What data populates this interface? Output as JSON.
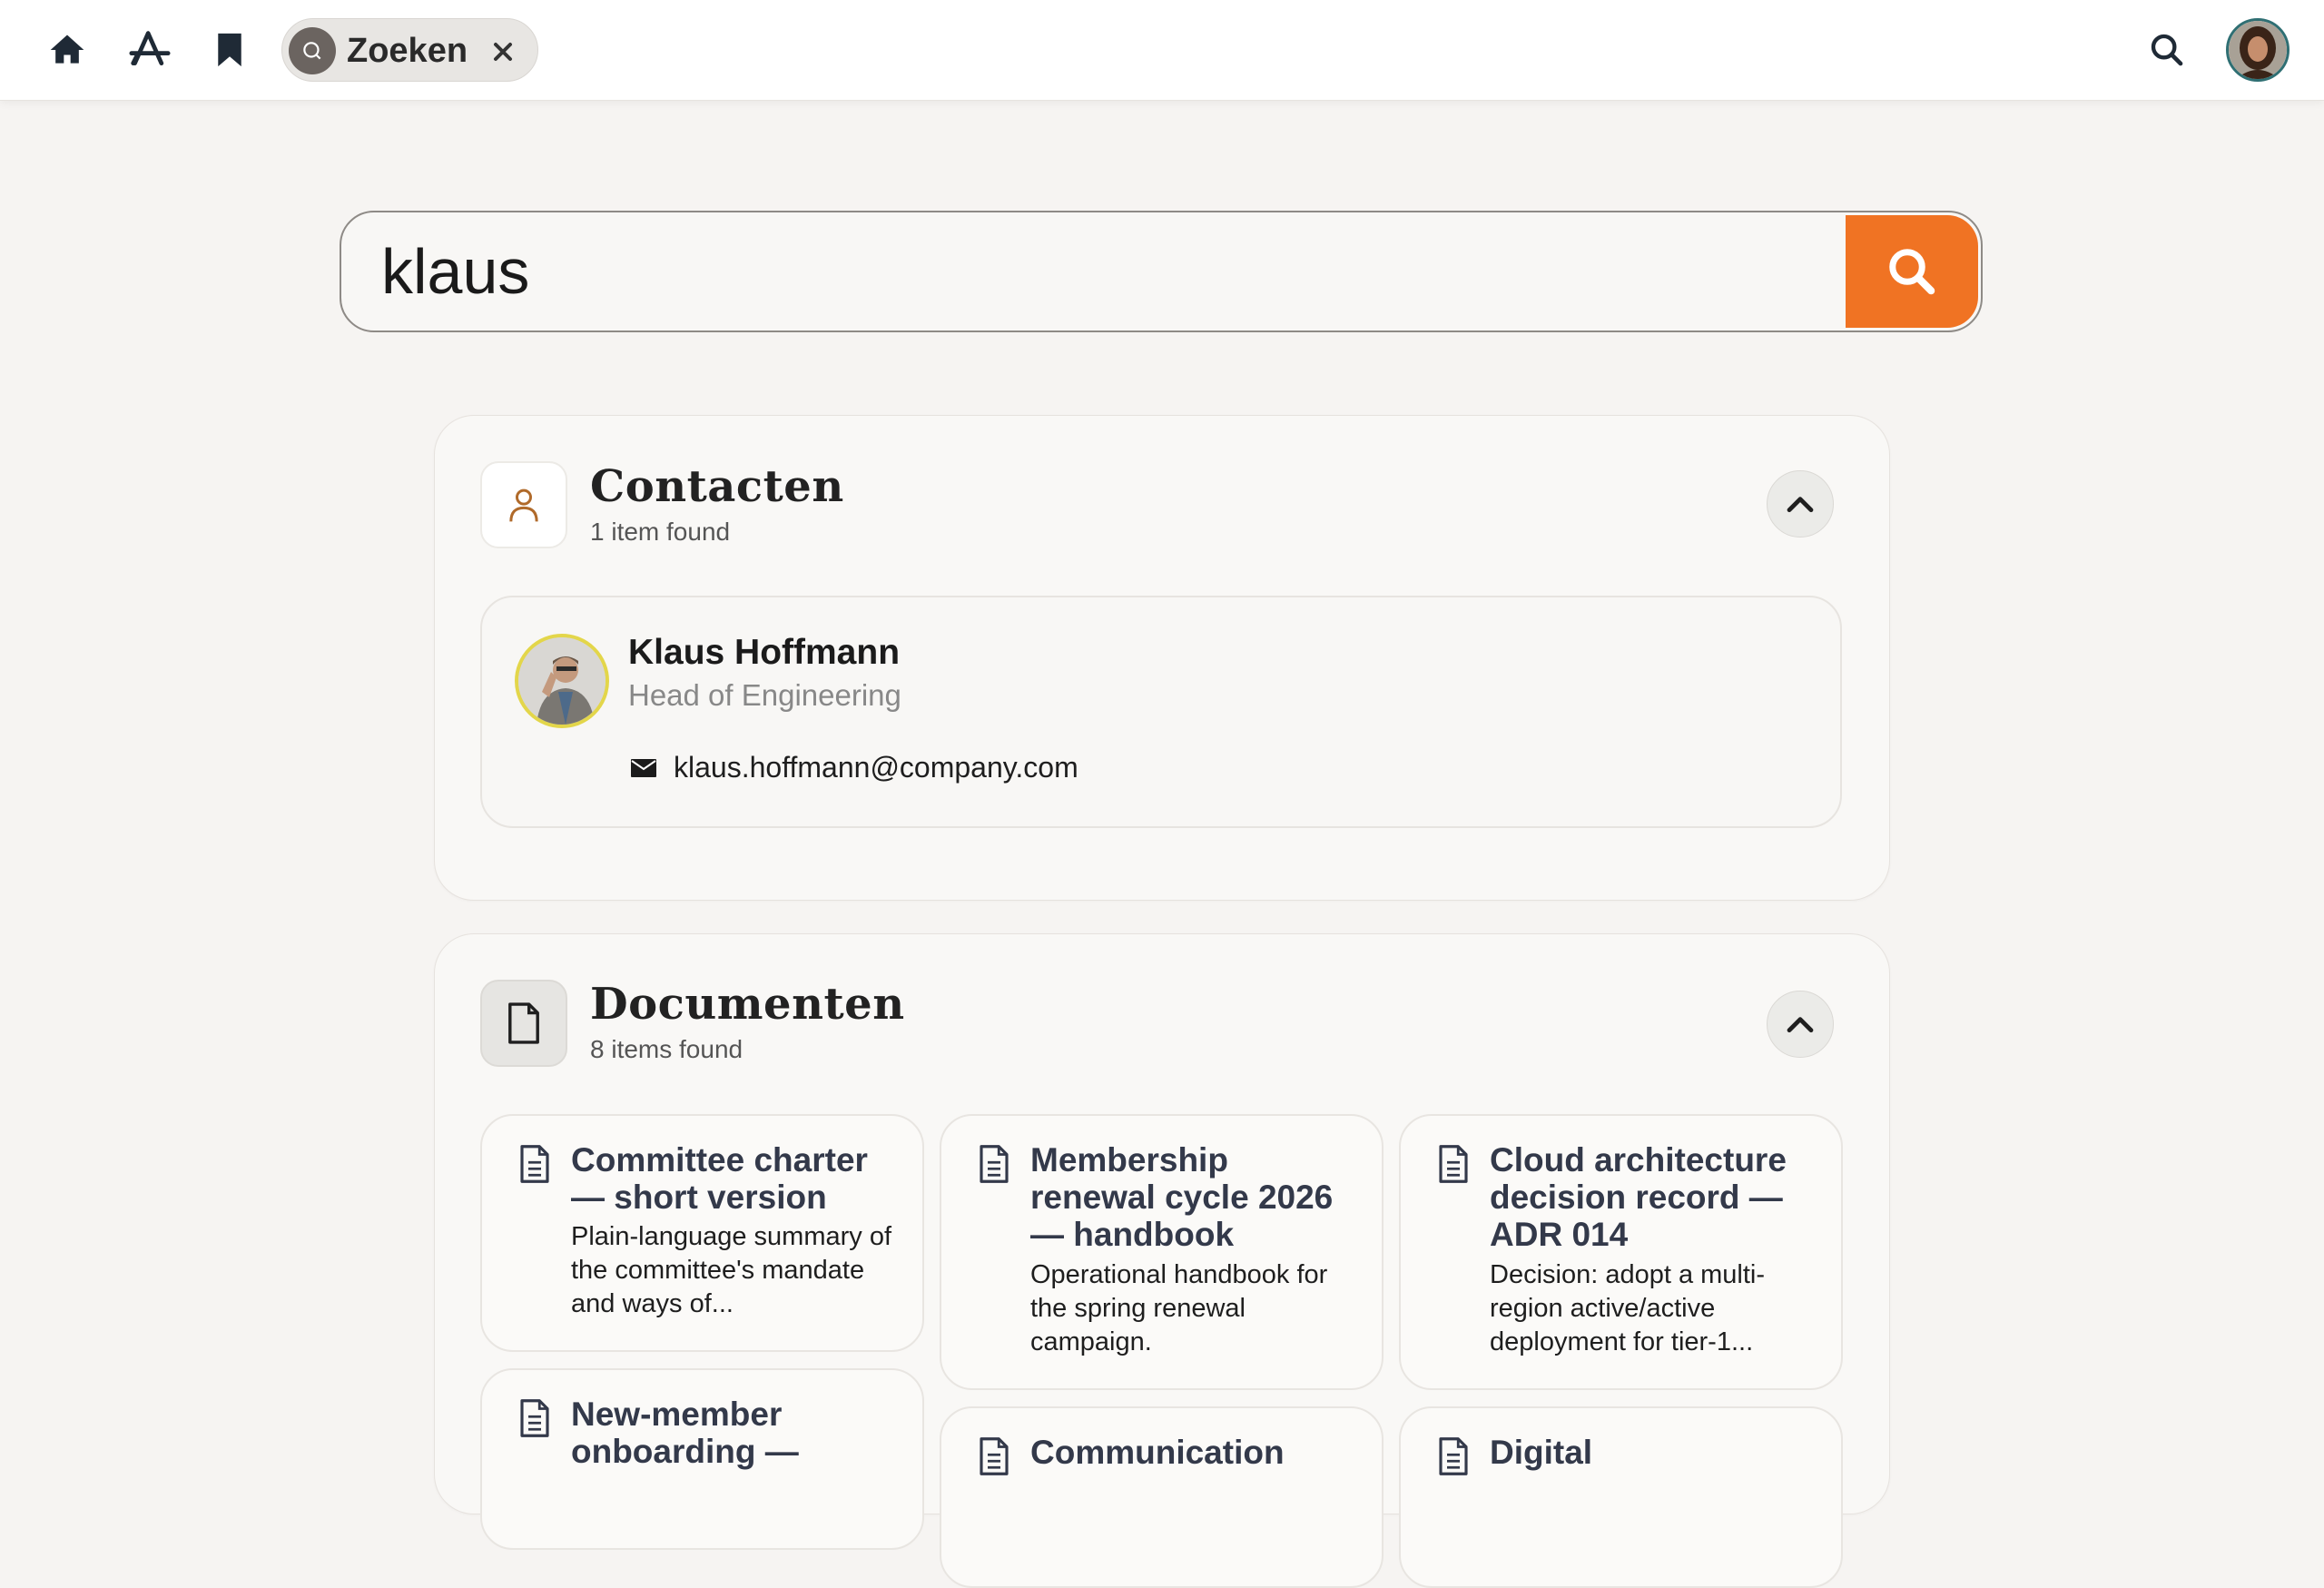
{
  "topbar": {
    "nav_icons": [
      "home-icon",
      "app-store-icon",
      "bookmark-icon"
    ],
    "tab": {
      "label": "Zoeken",
      "icon": "search-icon",
      "close_icon": "close-icon"
    },
    "right_icons": [
      "search-icon",
      "user-avatar"
    ]
  },
  "search": {
    "value": "klaus",
    "button_icon": "search-icon",
    "button_color": "#f07323"
  },
  "contacts_section": {
    "title": "Contacten",
    "count": "1 item found",
    "icon": "person-icon",
    "collapse_icon": "chevron-up-icon",
    "items": [
      {
        "name": "Klaus Hoffmann",
        "role": "Head of Engineering",
        "email": "klaus.hoffmann@company.com"
      }
    ]
  },
  "documents_section": {
    "title": "Documenten",
    "count": "8 items found",
    "icon": "document-icon",
    "collapse_icon": "chevron-up-icon",
    "items": [
      {
        "title": "Committee charter — short version",
        "description": "Plain-language summary of the committee's mandate and ways of..."
      },
      {
        "title": "Membership renewal cycle 2026 — handbook",
        "description": "Operational handbook for the spring renewal campaign."
      },
      {
        "title": "Cloud architecture decision record — ADR 014",
        "description": "Decision: adopt a multi-region active/active deployment for tier-1..."
      },
      {
        "title": "New-member onboarding —",
        "description": ""
      },
      {
        "title": "Communication",
        "description": ""
      },
      {
        "title": "Digital",
        "description": ""
      }
    ]
  },
  "colors": {
    "accent": "#f07323",
    "background": "#f6f4f2",
    "doc_title": "#33394a"
  }
}
